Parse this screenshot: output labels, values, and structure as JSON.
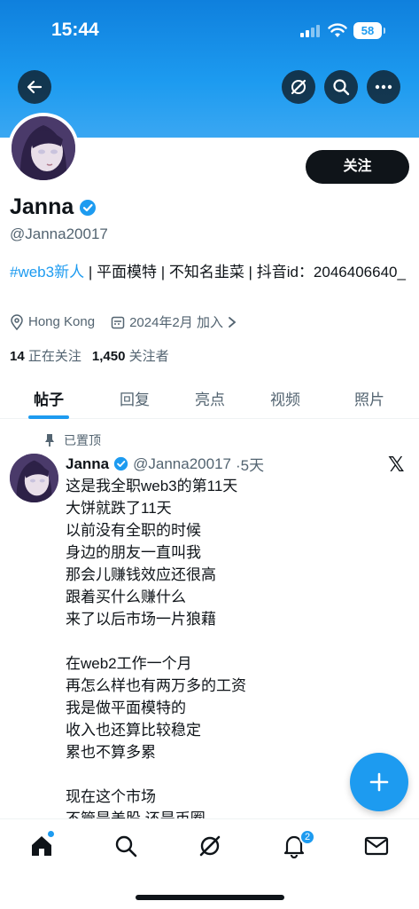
{
  "status_bar": {
    "time": "15:44",
    "battery": "58"
  },
  "profile": {
    "name": "Janna",
    "handle": "@Janna20017",
    "follow_label": "关注",
    "bio_tag": "#web3新人",
    "bio_rest": " | 平面模特 | 不知名韭菜 | 抖音id：2046406640_",
    "location": "Hong Kong",
    "joined": "2024年2月 加入",
    "following_count": "14",
    "following_label": "正在关注",
    "followers_count": "1,450",
    "followers_label": "关注者"
  },
  "tabs": [
    "帖子",
    "回复",
    "亮点",
    "视频",
    "照片"
  ],
  "post": {
    "pinned_label": "已置顶",
    "author": "Janna",
    "handle": "@Janna20017",
    "time": "·5天",
    "lines": [
      "这是我全职web3的第11天",
      "大饼就跌了11天",
      "以前没有全职的时候",
      "身边的朋友一直叫我",
      "那会儿赚钱效应还很高",
      "跟着买什么赚什么",
      "来了以后市场一片狼藉",
      "",
      "在web2工作一个月",
      "再怎么样也有两万多的工资",
      "我是做平面模特的",
      "收入也还算比较稳定",
      "累也不算多累",
      "",
      "现在这个市场",
      "不管是美股 还是币圈"
    ]
  },
  "nav": {
    "notifications_badge": "2"
  },
  "icons": [
    "back-arrow-icon",
    "grok-icon",
    "search-icon",
    "more-icon",
    "verified-icon",
    "location-icon",
    "calendar-icon",
    "pin-icon",
    "x-logo-icon",
    "plus-icon",
    "home-icon",
    "bell-icon",
    "mail-icon"
  ],
  "colors": {
    "accent": "#1d9bf0",
    "text": "#0f1419",
    "muted": "#536471"
  }
}
